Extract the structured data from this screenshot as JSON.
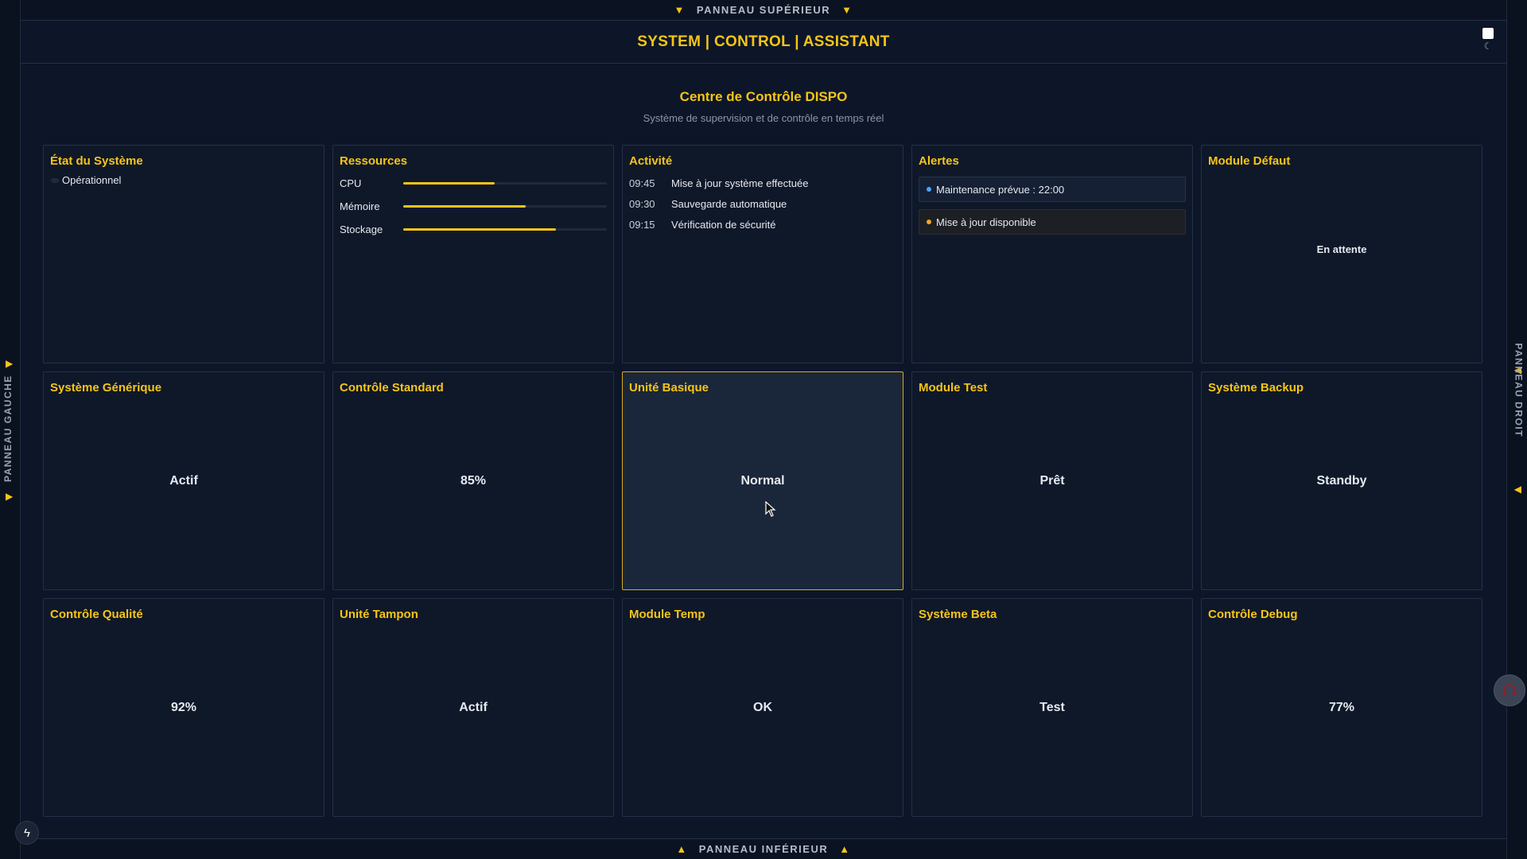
{
  "panels": {
    "top": "PANNEAU SUPÉRIEUR",
    "bottom": "PANNEAU INFÉRIEUR",
    "left": "PANNEAU GAUCHE",
    "right": "PANNEAU DROIT"
  },
  "header": {
    "title": "SYSTEM | CONTROL | ASSISTANT"
  },
  "page": {
    "title": "Centre de Contrôle DISPO",
    "subtitle": "Système de supervision et de contrôle en temps réel"
  },
  "cards": {
    "etat": {
      "title": "État du Système",
      "status": "Opérationnel"
    },
    "ressources": {
      "title": "Ressources",
      "items": [
        {
          "label": "CPU",
          "level": 0.45
        },
        {
          "label": "Mémoire",
          "level": 0.6
        },
        {
          "label": "Stockage",
          "level": 0.75
        }
      ]
    },
    "activite": {
      "title": "Activité",
      "items": [
        {
          "time": "09:45",
          "text": "Mise à jour système effectuée"
        },
        {
          "time": "09:30",
          "text": "Sauvegarde automatique"
        },
        {
          "time": "09:15",
          "text": "Vérification de sécurité"
        }
      ]
    },
    "alertes": {
      "title": "Alertes",
      "items": [
        {
          "text": "Maintenance prévue : 22:00",
          "color": "#4da3ff"
        },
        {
          "text": "Mise à jour disponible",
          "color": "#f5a623"
        }
      ]
    },
    "module_defaut": {
      "title": "Module Défaut",
      "value": "En attente"
    },
    "modules": [
      {
        "title": "Système Générique",
        "value": "Actif"
      },
      {
        "title": "Contrôle Standard",
        "value": "85%"
      },
      {
        "title": "Unité Basique",
        "value": "Normal"
      },
      {
        "title": "Module Test",
        "value": "Prêt"
      },
      {
        "title": "Système Backup",
        "value": "Standby"
      },
      {
        "title": "Contrôle Qualité",
        "value": "92%"
      },
      {
        "title": "Unité Tampon",
        "value": "Actif"
      },
      {
        "title": "Module Temp",
        "value": "OK"
      },
      {
        "title": "Système Beta",
        "value": "Test"
      },
      {
        "title": "Contrôle Debug",
        "value": "77%"
      }
    ]
  },
  "icons": {
    "theme_sun": "square-icon",
    "theme_moon": "moon-icon",
    "help": "headset-icon",
    "bolt": "bolt-icon"
  },
  "colors": {
    "accent": "#f5c518",
    "background": "#0b1322",
    "card": "#0f1829",
    "selected_card": "#1a2639"
  }
}
